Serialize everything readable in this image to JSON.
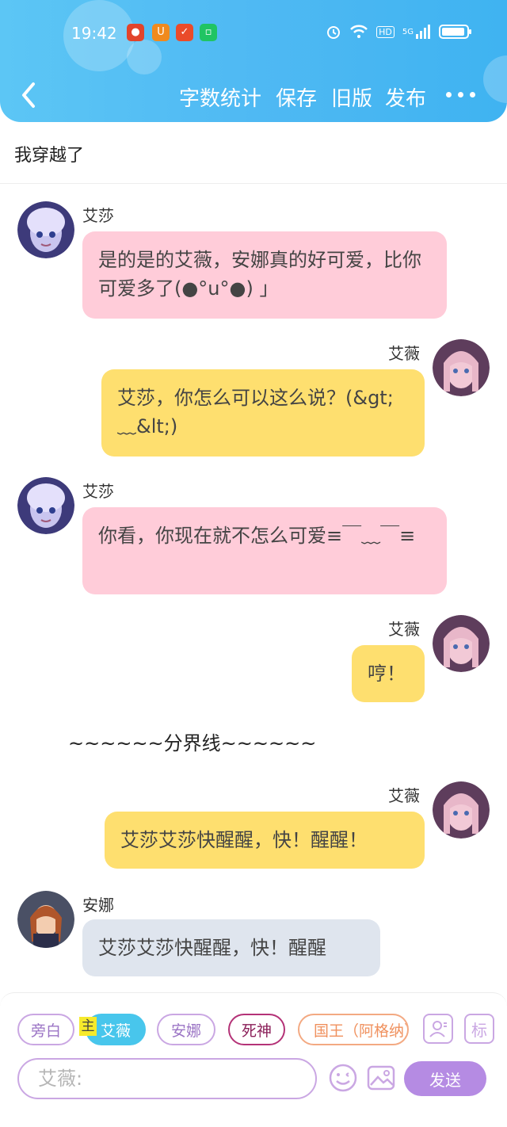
{
  "status_bar": {
    "time": "19:42",
    "network": "5G",
    "hd": "HD"
  },
  "nav": {
    "word_count": "字数统计",
    "save": "保存",
    "old_version": "旧版",
    "publish": "发布"
  },
  "story": {
    "title": "我穿越了"
  },
  "messages": [
    {
      "sender": "艾莎",
      "text": "是的是的艾薇，安娜真的好可爱，比你可爱多了(●°u°●)​ 」"
    },
    {
      "sender": "艾薇",
      "text": "艾莎，你怎么可以这么说？(&gt;﹏&lt;)"
    },
    {
      "sender": "艾莎",
      "text": "你看，你现在就不怎么可爱≡￣﹏￣≡"
    },
    {
      "sender": "艾薇",
      "text": "哼！"
    },
    {
      "sender": "艾薇",
      "text": "艾莎艾莎快醒醒，快！醒醒！"
    },
    {
      "sender": "安娜",
      "text": "艾莎艾莎快醒醒，快！醒醒"
    }
  ],
  "divider": "~~~~~~分界线~~~~~~",
  "roles": {
    "narration": "旁白",
    "main_tag": "主",
    "avie": "艾薇",
    "anna": "安娜",
    "death": "死神",
    "king": "国王（阿格纳）",
    "tag_button": "标"
  },
  "input": {
    "placeholder": "艾薇:"
  },
  "send_label": "发送"
}
